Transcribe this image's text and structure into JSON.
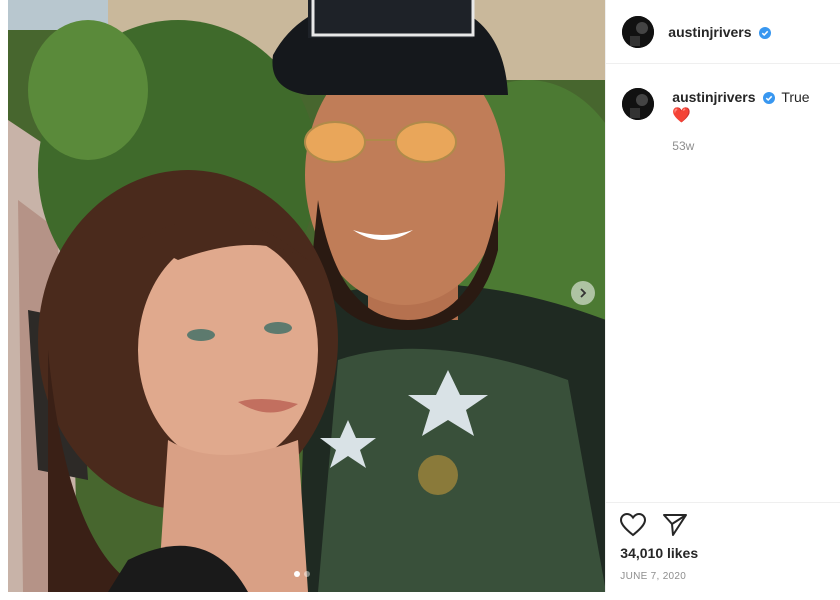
{
  "post": {
    "username": "austinjrivers",
    "caption": "True",
    "caption_emoji": "❤️",
    "time_ago": "53w",
    "likes": "34,010 likes",
    "date": "JUNE 7, 2020",
    "carousel_total": 2,
    "carousel_index": 1
  },
  "icons": {
    "verified": "verified-badge-icon",
    "like": "heart-icon",
    "share": "paper-plane-icon",
    "next": "chevron-right-icon"
  },
  "colors": {
    "verified_blue": "#3897f0",
    "muted_text": "#8e8e8e",
    "heart_red": "#e0245e"
  }
}
